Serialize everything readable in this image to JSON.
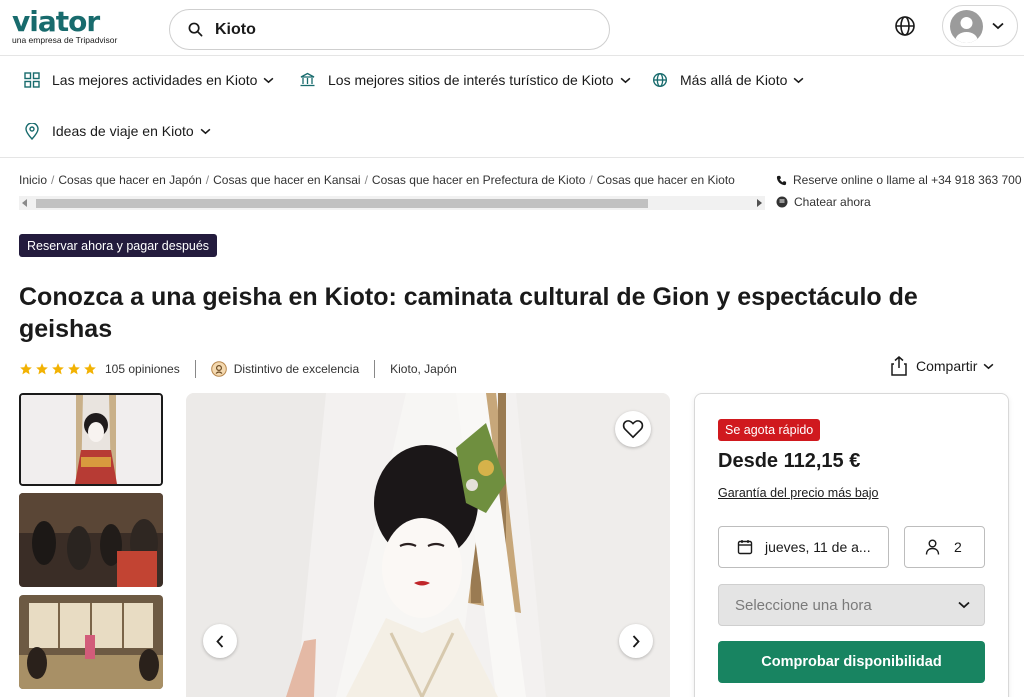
{
  "header": {
    "logo": "viator",
    "logo_sub": "una empresa de Tripadvisor",
    "search_value": "Kioto",
    "globe_icon": "globe-icon",
    "profile_icon": "avatar-icon"
  },
  "nav": {
    "items": [
      {
        "label": "Las mejores actividades en Kioto",
        "icon": "grid-icon"
      },
      {
        "label": "Los mejores sitios de interés turístico de Kioto",
        "icon": "landmark-icon"
      },
      {
        "label": "Más allá de Kioto",
        "icon": "globe-icon"
      },
      {
        "label": "Ideas de viaje en Kioto",
        "icon": "location-pin-icon"
      }
    ]
  },
  "breadcrumb": [
    "Inicio",
    "Cosas que hacer en Japón",
    "Cosas que hacer en Kansai",
    "Cosas que hacer en Prefectura de Kioto",
    "Cosas que hacer en Kioto"
  ],
  "contact": {
    "phone_text": "Reserve online o llame al",
    "phone_number": "+34 918 363 700",
    "chat_text": "Chatear ahora"
  },
  "product": {
    "badge": "Reservar ahora y pagar después",
    "title": "Conozca a una geisha en Kioto: caminata cultural de Gion y espectáculo de geishas",
    "rating": 5,
    "reviews": "105 opiniones",
    "excellence": "Distintivo de excelencia",
    "location": "Kioto, Japón",
    "share": "Compartir"
  },
  "booking": {
    "urgency": "Se agota rápido",
    "price": "Desde 112,15 €",
    "guarantee": "Garantía del precio más bajo",
    "date": "jueves, 11 de a...",
    "travelers": "2",
    "time_placeholder": "Seleccione una hora",
    "check_button": "Comprobar disponibilidad"
  },
  "colors": {
    "brand": "#186b6d",
    "cta": "#188461",
    "urgency": "#d0191e",
    "badge_dark": "#231b3d",
    "star": "#f2b203"
  }
}
